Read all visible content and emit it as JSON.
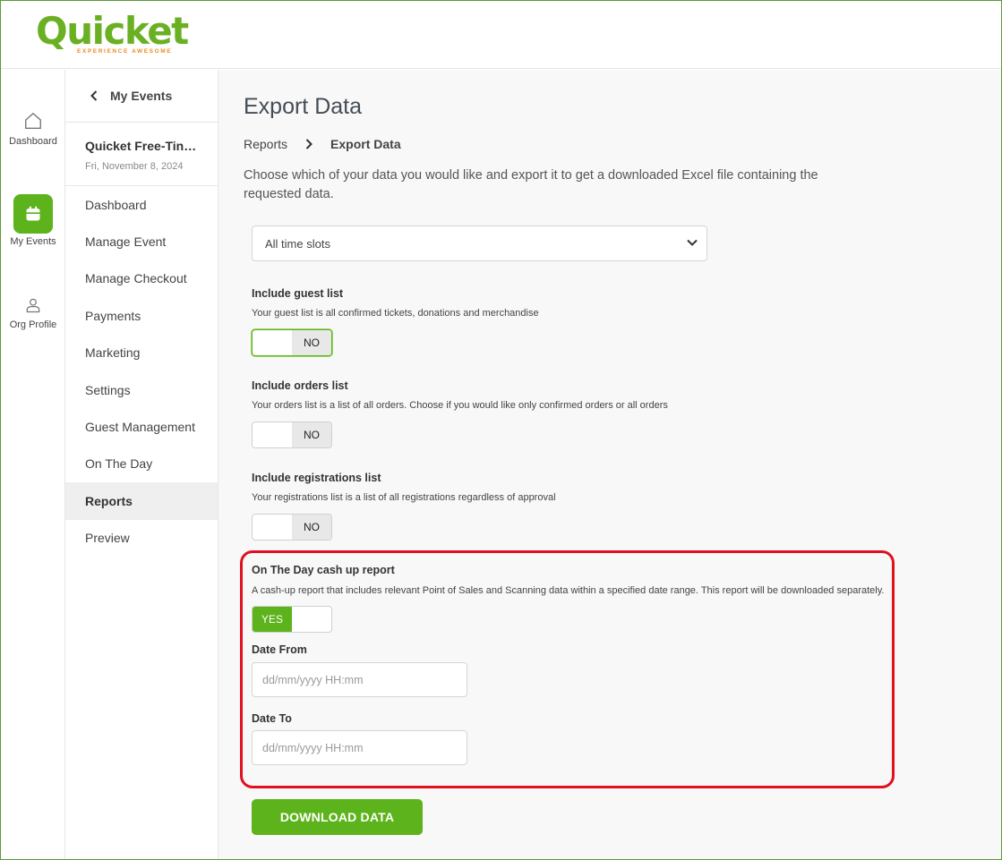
{
  "brand": {
    "name": "Quicket",
    "tagline": "EXPERIENCE AWESOME",
    "primary_color": "#5db31b",
    "accent_color": "#f08a1c"
  },
  "rail": {
    "items": [
      {
        "label": "Dashboard",
        "icon": "home-icon"
      },
      {
        "label": "My Events",
        "icon": "calendar-icon",
        "active": true
      },
      {
        "label": "Org Profile",
        "icon": "user-icon"
      }
    ]
  },
  "event_nav": {
    "back_label": "My Events",
    "event_name": "Quicket Free-Tin…",
    "event_date": "Fri, November 8, 2024",
    "items": [
      {
        "label": "Dashboard"
      },
      {
        "label": "Manage Event"
      },
      {
        "label": "Manage Checkout"
      },
      {
        "label": "Payments"
      },
      {
        "label": "Marketing"
      },
      {
        "label": "Settings"
      },
      {
        "label": "Guest Management"
      },
      {
        "label": "On The Day"
      },
      {
        "label": "Reports",
        "active": true
      },
      {
        "label": "Preview"
      }
    ]
  },
  "main": {
    "title": "Export Data",
    "breadcrumb": [
      "Reports",
      "Export Data"
    ],
    "intro": "Choose which of your data you would like and export it to get a downloaded Excel file containing the requested data.",
    "time_slot_select": {
      "value": "All time slots"
    },
    "sections": {
      "guest_list": {
        "title": "Include guest list",
        "description": "Your guest list is all confirmed tickets, donations and merchandise",
        "toggle": "NO"
      },
      "orders_list": {
        "title": "Include orders list",
        "description": "Your orders list is a list of all orders. Choose if you would like only confirmed orders or all orders",
        "toggle": "NO"
      },
      "registrations_list": {
        "title": "Include registrations list",
        "description": "Your registrations list is a list of all registrations regardless of approval",
        "toggle": "NO"
      },
      "cash_up": {
        "title": "On The Day cash up report",
        "description": "A cash-up report that includes relevant Point of Sales and Scanning data within a specified date range. This report will be downloaded separately.",
        "toggle": "YES",
        "date_from_label": "Date From",
        "date_from_placeholder": "dd/mm/yyyy HH:mm",
        "date_to_label": "Date To",
        "date_to_placeholder": "dd/mm/yyyy HH:mm"
      }
    },
    "download_label": "DOWNLOAD DATA"
  }
}
